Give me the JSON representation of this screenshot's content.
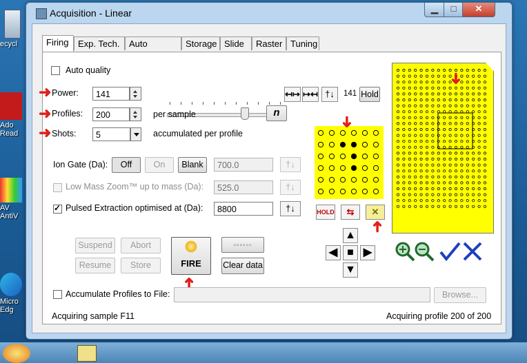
{
  "window": {
    "title": "Acquisition - Linear",
    "minimize": "▁",
    "maximize": "□",
    "close": "✕"
  },
  "desktop": {
    "icons": [
      {
        "label": "ecycl"
      },
      {
        "label": "Ado Read"
      },
      {
        "label": "AV AntiV"
      },
      {
        "label": "Micro Edg"
      }
    ]
  },
  "tabs": [
    "Firing",
    "Exp. Tech.",
    "Auto Quality",
    "Storage",
    "Slide",
    "Raster",
    "Tuning"
  ],
  "firing": {
    "auto_quality_label": "Auto quality",
    "power_label": "Power:",
    "power_value": "141",
    "profiles_label": "Profiles:",
    "profiles_value": "200",
    "profiles_unit": "per sample",
    "shots_label": "Shots:",
    "shots_value": "5",
    "shots_unit": "accumulated per profile",
    "power_readout": "141",
    "hold_label": "Hold",
    "n_label": "n",
    "slider_level_fraction": 0.68,
    "ion_gate_label": "Ion Gate (Da):",
    "ion_gate_off": "Off",
    "ion_gate_on": "On",
    "ion_gate_blank": "Blank",
    "ion_gate_value": "700.0",
    "low_mass_label": "Low Mass Zoom™ up to mass (Da):",
    "low_mass_value": "525.0",
    "pulsed_label": "Pulsed Extraction optimised at (Da):",
    "pulsed_value": "8800",
    "suspend_label": "Suspend",
    "abort_label": "Abort",
    "resume_label": "Resume",
    "store_label": "Store",
    "fire_label": "FIRE",
    "clear_data_label": "Clear data",
    "hold_icon_label": "HOLD",
    "accumulate_label": "Accumulate Profiles to File:",
    "browse_label": "Browse...",
    "status_left": "Acquiring sample F11",
    "status_right": "Acquiring profile 200 of 200"
  },
  "colors": {
    "plate_yellow": "#ffff00",
    "annotation_red": "#e0201b",
    "zoom_green": "#2e7d32",
    "action_blue": "#1d3fbf"
  }
}
